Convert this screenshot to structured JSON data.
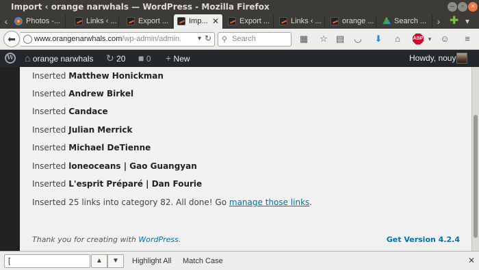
{
  "window": {
    "title": "Import ‹ orange narwhals — WordPress - Mozilla Firefox"
  },
  "tabs": [
    {
      "label": "Photos -...",
      "favicon": "photos-icon",
      "active": false
    },
    {
      "label": "Links ‹ ...",
      "favicon": "wordpress-icon",
      "active": false
    },
    {
      "label": "Export ...",
      "favicon": "wordpress-icon",
      "active": false
    },
    {
      "label": "Imp...",
      "favicon": "wordpress-icon",
      "active": true
    },
    {
      "label": "Export ...",
      "favicon": "wordpress-icon",
      "active": false
    },
    {
      "label": "Links ‹ ...",
      "favicon": "wordpress-icon",
      "active": false
    },
    {
      "label": "orange ...",
      "favicon": "wordpress-icon",
      "active": false
    },
    {
      "label": "Search ...",
      "favicon": "drive-icon",
      "active": false
    }
  ],
  "navbar": {
    "url_host": "www.orangenarwhals.com",
    "url_path": "/wp-admin/admin.php?imp",
    "search_placeholder": "Search"
  },
  "adminbar": {
    "site_name": "orange narwhals",
    "updates_count": "20",
    "comments_count": "0",
    "new_label": "New",
    "greeting": "Howdy, nouy"
  },
  "log": {
    "prefix": "Inserted",
    "entries": [
      "Matthew Honickman",
      "Andrew Birkel",
      "Candace",
      "Julian Merrick",
      "Michael DeTienne",
      "loneoceans | Gao Guangyan",
      "L'esprit Préparé | Dan Fourie"
    ],
    "summary_text": "Inserted 25 links into category 82. All done! Go",
    "summary_link": "manage those links",
    "summary_end": "."
  },
  "footer": {
    "thanks_text": "Thank you for creating with",
    "thanks_link": "WordPress",
    "thanks_end": ".",
    "version": "Get Version 4.2.4"
  },
  "findbar": {
    "value": "[",
    "highlight_all": "Highlight All",
    "match_case": "Match Case"
  }
}
